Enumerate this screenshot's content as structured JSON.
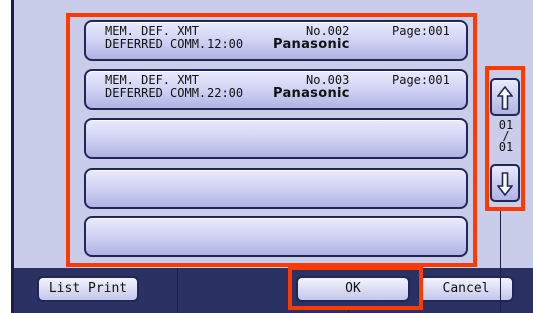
{
  "job_list": {
    "rows": [
      {
        "type_line1": "MEM. DEF. XMT",
        "type_line2": "DEFERRED COMM.",
        "time": "12:00",
        "number": "No.002",
        "page": "Page:001",
        "name": "Panasonic"
      },
      {
        "type_line1": "MEM. DEF. XMT",
        "type_line2": "DEFERRED COMM.",
        "time": "22:00",
        "number": "No.003",
        "page": "Page:001",
        "name": "Panasonic"
      }
    ],
    "empty_rows": 3
  },
  "scroll": {
    "up_icon": "arrow-up-icon",
    "down_icon": "arrow-down-icon",
    "page_current": "01",
    "page_separator": "/",
    "page_total": "01"
  },
  "buttons": {
    "list_print": "List Print",
    "ok": "OK",
    "cancel": "Cancel"
  },
  "colors": {
    "highlight": "#ff3a00",
    "screen_background": "#c9cdea",
    "bottom_bar": "#2a3163"
  }
}
